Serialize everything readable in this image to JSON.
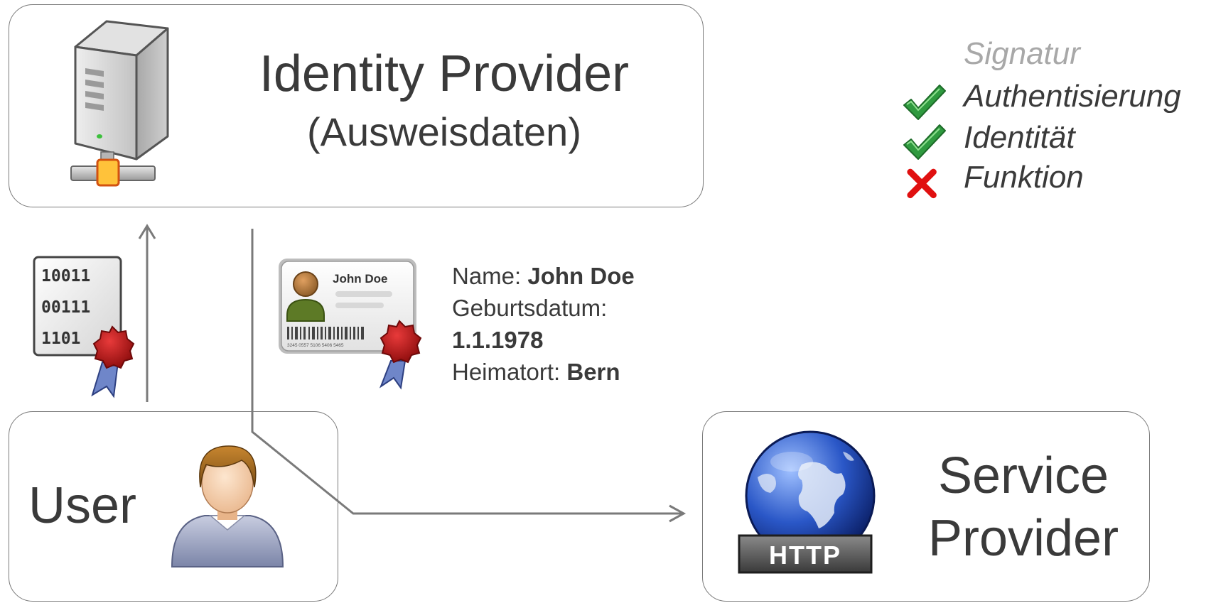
{
  "identity_provider": {
    "title": "Identity Provider",
    "subtitle": "(Ausweisdaten)"
  },
  "user": {
    "title": "User"
  },
  "service_provider": {
    "title_line1": "Service",
    "title_line2": "Provider",
    "badge": "HTTP"
  },
  "legend": {
    "signatur": "Signatur",
    "authentisierung": "Authentisierung",
    "identitaet": "Identität",
    "funktion": "Funktion"
  },
  "signed_data_icon": {
    "binary_row1": "10011",
    "binary_row2": "00111",
    "binary_row3": "1101"
  },
  "id_card": {
    "card_name": "John Doe",
    "card_number": "3245 0557 5106 5406 5465",
    "name_label": "Name: ",
    "name_value": "John Doe",
    "birth_label": "Geburtsdatum:",
    "birth_value": "1.1.1978",
    "hometown_label": "Heimatort: ",
    "hometown_value": "Bern"
  },
  "colors": {
    "box_border": "#7a7a7a",
    "text": "#3a3a3a",
    "legend_muted": "#a8a8a8",
    "arrow": "#7a7a7a",
    "check_green": "#2f9a3f",
    "cross_red": "#e01010",
    "seal_red": "#b81414"
  },
  "icons": {
    "server": "server-icon",
    "user": "user-avatar-icon",
    "globe": "globe-http-icon",
    "binary_doc": "signed-binary-document-icon",
    "id_card": "id-card-icon",
    "check": "check-icon",
    "cross": "cross-icon"
  }
}
